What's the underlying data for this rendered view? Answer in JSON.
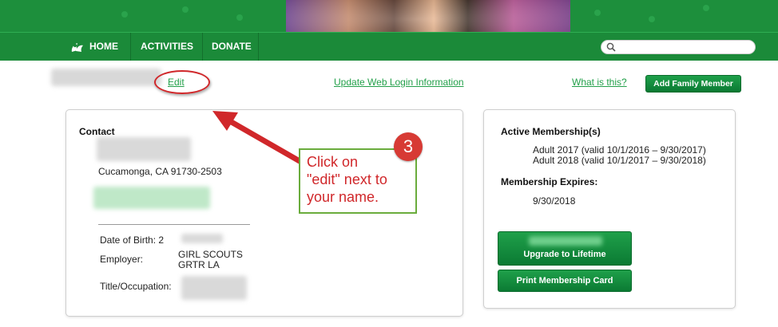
{
  "nav": {
    "home": "HOME",
    "activities": "ACTIVITIES",
    "donate": "DONATE",
    "search_placeholder": ""
  },
  "profile": {
    "edit_label": "Edit",
    "web_login_label": "Update Web Login Information",
    "what_is_this_label": "What is this?",
    "add_family_label": "Add Family Member"
  },
  "contact": {
    "title": "Contact",
    "city_line": "Cucamonga, CA 91730-2503",
    "dob_label": "Date of Birth: 2",
    "employer_label": "Employer:",
    "employer_value_line1": "GIRL SCOUTS",
    "employer_value_line2": "GRTR LA",
    "title_label": "Title/Occupation:"
  },
  "membership": {
    "active_title": "Active Membership(s)",
    "items": [
      "Adult 2017 (valid 10/1/2016 – 9/30/2017)",
      "Adult 2018 (valid 10/1/2017 – 9/30/2018)"
    ],
    "expires_title": "Membership Expires:",
    "expires_value": "9/30/2018",
    "upgrade_label": "Upgrade to Lifetime",
    "print_label": "Print Membership Card"
  },
  "annotation": {
    "step_number": "3",
    "text": "Click on\n\"edit\" next to\nyour name."
  },
  "colors": {
    "brand_green": "#1d8f3c",
    "link_green": "#23a04a",
    "annotation_red": "#d0272a",
    "callout_border": "#6aac3c"
  }
}
